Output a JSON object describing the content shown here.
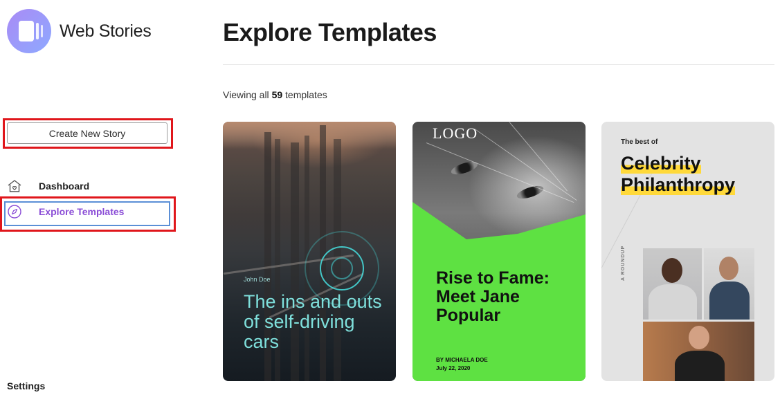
{
  "brand": {
    "name": "Web Stories"
  },
  "sidebar": {
    "create_button": "Create New Story",
    "nav": [
      {
        "label": "Dashboard",
        "icon": "home-icon"
      },
      {
        "label": "Explore Templates",
        "icon": "compass-icon",
        "active": true
      }
    ],
    "settings": "Settings"
  },
  "main": {
    "title": "Explore Templates",
    "count_prefix": "Viewing all",
    "count_value": "59",
    "count_suffix": "templates"
  },
  "templates": [
    {
      "author": "John Doe",
      "title": "The ins and outs of self-driving cars"
    },
    {
      "logo": "LOGO",
      "title": "Rise to Fame: Meet Jane Popular",
      "byline": "BY MICHAELA DOE",
      "date": "July 22, 2020"
    },
    {
      "kicker": "The best of",
      "title_line1": "Celebrity",
      "title_line2": "Philanthropy",
      "side_label": "A ROUNDUP"
    }
  ],
  "colors": {
    "accent_active": "#8a4cd6",
    "highlight_outline": "#e0161b",
    "focus_ring": "#5b8fd6",
    "fame_green": "#5ee142",
    "celeb_highlight": "#ffd93a",
    "city_text": "#7fe0dc"
  }
}
